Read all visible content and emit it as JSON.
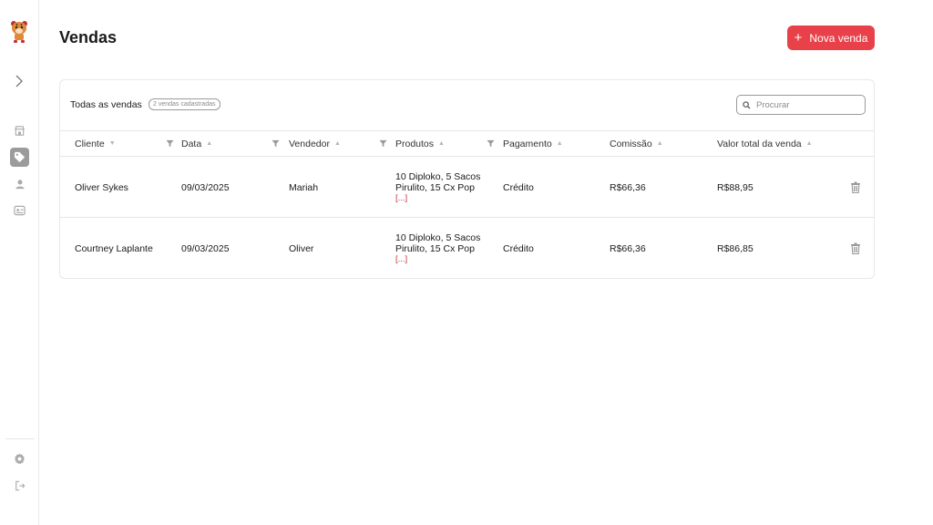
{
  "header": {
    "title": "Vendas",
    "new_button_icon": "+",
    "new_button_label": "Nova venda",
    "accent_color": "#e8414a"
  },
  "sidebar": {
    "items": [
      {
        "icon": "store-icon"
      },
      {
        "icon": "tag-icon",
        "active": true
      },
      {
        "icon": "user-icon"
      },
      {
        "icon": "id-card-icon"
      }
    ],
    "bottom": [
      {
        "icon": "gear-icon"
      },
      {
        "icon": "logout-icon"
      }
    ]
  },
  "table": {
    "title": "Todas as vendas",
    "badge": "2 vendas cadastradas",
    "search_placeholder": "Procurar",
    "columns": [
      "Cliente",
      "Data",
      "Vendedor",
      "Produtos",
      "Pagamento",
      "Comissão",
      "Valor total da venda"
    ],
    "rows": [
      {
        "cliente": "Oliver Sykes",
        "data": "09/03/2025",
        "vendedor": "Mariah",
        "produtos": "10 Diploko, 5 Sacos Pirulito, 15 Cx Pop",
        "produtos_more": "[...]",
        "pagamento": "Crédito",
        "comissao": "R$66,36",
        "valor_total": "R$88,95"
      },
      {
        "cliente": "Courtney Laplante",
        "data": "09/03/2025",
        "vendedor": "Oliver",
        "produtos": "10 Diploko, 5 Sacos Pirulito, 15 Cx Pop",
        "produtos_more": "[...]",
        "pagamento": "Crédito",
        "comissao": "R$66,36",
        "valor_total": "R$86,85"
      }
    ]
  }
}
